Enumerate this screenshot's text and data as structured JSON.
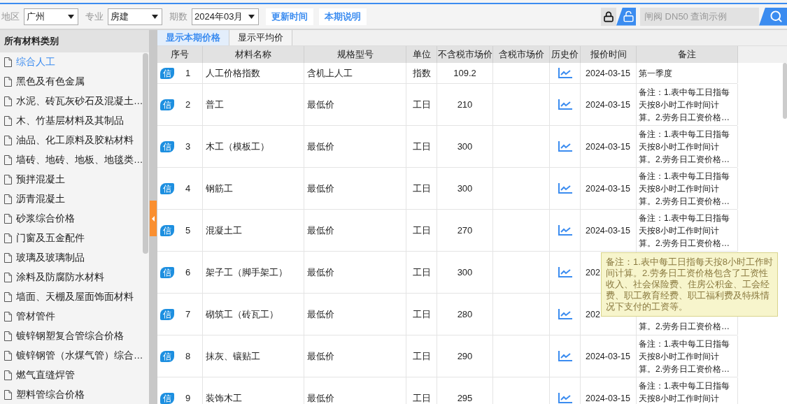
{
  "filters": [
    {
      "label": "地区",
      "value": "广州"
    },
    {
      "label": "专业",
      "value": "房建"
    },
    {
      "label": "期数",
      "value": "2024年03月"
    }
  ],
  "actions": [
    "更新时间",
    "本期说明"
  ],
  "search": {
    "placeholder": "闸阀 DN50 查询示例"
  },
  "sidebar": {
    "title": "所有材料类别",
    "items": [
      {
        "label": "综合人工",
        "selected": true
      },
      {
        "label": "黑色及有色金属",
        "selected": false
      },
      {
        "label": "水泥、砖瓦灰砂石及混凝土…",
        "selected": false
      },
      {
        "label": "木、竹基层材料及其制品",
        "selected": false
      },
      {
        "label": "油品、化工原料及胶粘材料",
        "selected": false
      },
      {
        "label": "墙砖、地砖、地板、地毯类…",
        "selected": false
      },
      {
        "label": "预拌混凝土",
        "selected": false
      },
      {
        "label": "沥青混凝土",
        "selected": false
      },
      {
        "label": "砂浆综合价格",
        "selected": false
      },
      {
        "label": "门窗及五金配件",
        "selected": false
      },
      {
        "label": "玻璃及玻璃制品",
        "selected": false
      },
      {
        "label": "涂料及防腐防水材料",
        "selected": false
      },
      {
        "label": "墙面、天棚及屋面饰面材料",
        "selected": false
      },
      {
        "label": "管材管件",
        "selected": false
      },
      {
        "label": "镀锌钢塑复合管综合价格",
        "selected": false
      },
      {
        "label": "镀锌钢管（水煤气管）综合…",
        "selected": false
      },
      {
        "label": "燃气直缝焊管",
        "selected": false
      },
      {
        "label": "塑料管综合价格",
        "selected": false
      }
    ]
  },
  "view_tabs": [
    {
      "label": "显示本期价格",
      "selected": true
    },
    {
      "label": "显示平均价",
      "selected": false
    }
  ],
  "table": {
    "columns": [
      "序号",
      "材料名称",
      "规格型号",
      "单位",
      "不含税市场价",
      "含税市场价",
      "历史价",
      "报价时间",
      "备注"
    ],
    "rows": [
      {
        "kind": "single",
        "badge": "信",
        "no": "1",
        "name": "人工价格指数",
        "spec": "含机上人工",
        "unit": "指数",
        "price": "109.2",
        "date": "2024-03-15",
        "remark": [
          "第一季度"
        ]
      },
      {
        "kind": "multi",
        "badge": "信",
        "no": "2",
        "name": "普工",
        "spec": "最低价",
        "unit": "工日",
        "price": "210",
        "date": "2024-03-15",
        "remark": [
          "备注：1.表中每工日指每",
          "天按8小时工作时间计",
          "算。2.劳务日工资价格…"
        ]
      },
      {
        "kind": "multi",
        "badge": "信",
        "no": "3",
        "name": "木工（模板工）",
        "spec": "最低价",
        "unit": "工日",
        "price": "300",
        "date": "2024-03-15",
        "remark": [
          "备注：1.表中每工日指每",
          "天按8小时工作时间计",
          "算。2.劳务日工资价格…"
        ]
      },
      {
        "kind": "multi",
        "badge": "信",
        "no": "4",
        "name": "钢筋工",
        "spec": "最低价",
        "unit": "工日",
        "price": "300",
        "date": "2024-03-15",
        "remark": [
          "备注：1.表中每工日指每",
          "天按8小时工作时间计",
          "算。2.劳务日工资价格…"
        ]
      },
      {
        "kind": "multi",
        "badge": "信",
        "no": "5",
        "name": "混凝土工",
        "spec": "最低价",
        "unit": "工日",
        "price": "270",
        "date": "2024-03-15",
        "remark": [
          "备注：1.表中每工日指每",
          "天按8小时工作时间计",
          "算。2.劳务日工资价格…"
        ]
      },
      {
        "kind": "multi",
        "badge": "信",
        "no": "6",
        "name": "架子工（脚手架工）",
        "spec": "最低价",
        "unit": "工日",
        "price": "300",
        "date": "202"
      },
      {
        "kind": "multi",
        "badge": "信",
        "no": "7",
        "name": "砌筑工（砖瓦工）",
        "spec": "最低价",
        "unit": "工日",
        "price": "280",
        "date": "202",
        "remark": [
          "算。2.劳务日工资价格…"
        ],
        "partly_hidden": true
      },
      {
        "kind": "multi",
        "badge": "信",
        "no": "8",
        "name": "抹灰、镶贴工",
        "spec": "最低价",
        "unit": "工日",
        "price": "290",
        "date": "2024-03-15",
        "remark": [
          "备注：1.表中每工日指每",
          "天按8小时工作时间计",
          "算。2.劳务日工资价格…"
        ]
      },
      {
        "kind": "multi",
        "badge": "信",
        "no": "9",
        "name": "装饰木工",
        "spec": "最低价",
        "unit": "工日",
        "price": "295",
        "date": "2024-03-15",
        "remark": [
          "备注：1.表中每工日指每",
          "天按8小时工作时间计"
        ]
      }
    ]
  },
  "tooltip": {
    "text": "备注：1.表中每工日指每天按8小时工作时间计算。2.劳务日工资价格包含了工资性收入、社会保险费、住房公积金、工会经费、职工教育经费、职工福利费及特殊情况下支付的工资等。"
  }
}
